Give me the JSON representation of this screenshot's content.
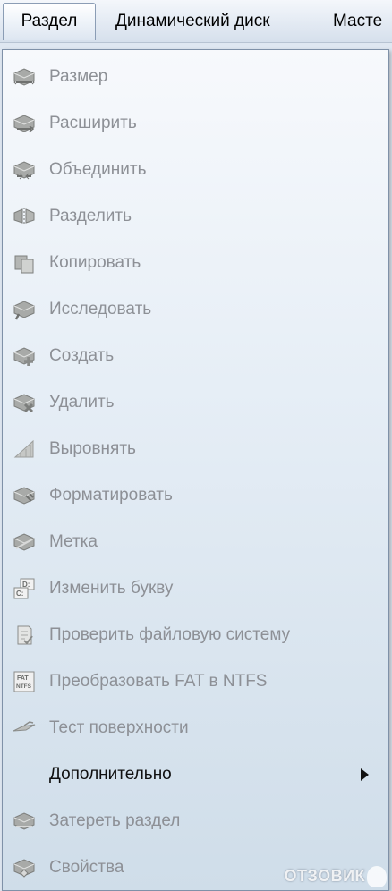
{
  "menubar": {
    "items": [
      {
        "label": "Раздел",
        "active": true
      },
      {
        "label": "Динамический диск"
      },
      {
        "label": "Масте"
      }
    ]
  },
  "menu": {
    "items": [
      {
        "label": "Размер",
        "icon": "disk-resize-icon",
        "enabled": false
      },
      {
        "label": "Расширить",
        "icon": "disk-extend-icon",
        "enabled": false
      },
      {
        "label": "Объединить",
        "icon": "disk-merge-icon",
        "enabled": false
      },
      {
        "label": "Разделить",
        "icon": "disk-split-icon",
        "enabled": false
      },
      {
        "label": "Копировать",
        "icon": "disk-copy-icon",
        "enabled": false
      },
      {
        "label": "Исследовать",
        "icon": "disk-explore-icon",
        "enabled": false
      },
      {
        "label": "Создать",
        "icon": "disk-create-icon",
        "enabled": false
      },
      {
        "label": "Удалить",
        "icon": "disk-delete-icon",
        "enabled": false
      },
      {
        "label": "Выровнять",
        "icon": "align-icon",
        "enabled": false
      },
      {
        "label": "Форматировать",
        "icon": "disk-format-icon",
        "enabled": false
      },
      {
        "label": "Метка",
        "icon": "disk-label-icon",
        "enabled": false
      },
      {
        "label": "Изменить букву",
        "icon": "drive-letter-icon",
        "enabled": false,
        "icon_text": "D: C:"
      },
      {
        "label": "Проверить файловую систему",
        "icon": "check-filesystem-icon",
        "enabled": false
      },
      {
        "label": "Преобразовать FAT в NTFS",
        "icon": "fat-to-ntfs-icon",
        "enabled": false,
        "icon_text": "FAT NTFS"
      },
      {
        "label": "Тест поверхности",
        "icon": "surface-test-icon",
        "enabled": false
      },
      {
        "label": "Дополнительно",
        "icon": "none",
        "enabled": true,
        "submenu": true
      },
      {
        "label": "Затереть раздел",
        "icon": "disk-wipe-icon",
        "enabled": false
      },
      {
        "label": "Свойства",
        "icon": "disk-properties-icon",
        "enabled": false
      }
    ]
  },
  "watermark": {
    "text": "ОТЗОВИК"
  },
  "colors": {
    "disabled_text": "#8d9096",
    "enabled_text": "#101010",
    "menu_border": "#7f91a8"
  }
}
